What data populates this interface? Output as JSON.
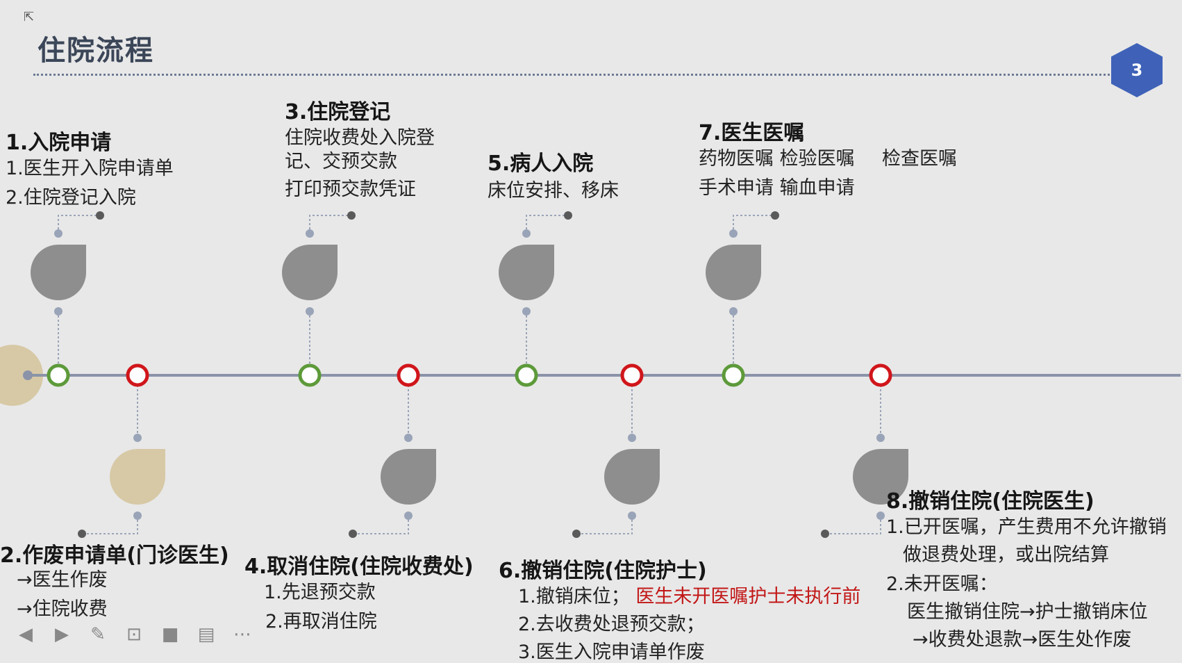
{
  "slide": {
    "title": "住院流程",
    "page_number": "3"
  },
  "steps": [
    {
      "id": "s1",
      "title": "1.入院申请",
      "lines": [
        "1.医生开入院申请单",
        "2.住院登记入院"
      ],
      "node_color": "green",
      "position": "top"
    },
    {
      "id": "s2",
      "title": "2.作废申请单(门诊医生)",
      "lines": [
        "→医生作废",
        "→住院收费"
      ],
      "node_color": "red",
      "position": "bottom"
    },
    {
      "id": "s3",
      "title": "3.住院登记",
      "lines": [
        "住院收费处入院登",
        "记、交预交款",
        "打印预交款凭证"
      ],
      "node_color": "green",
      "position": "top"
    },
    {
      "id": "s4",
      "title": "4.取消住院(住院收费处)",
      "lines": [
        "1.先退预交款",
        "2.再取消住院"
      ],
      "node_color": "red",
      "position": "bottom"
    },
    {
      "id": "s5",
      "title": "5.病人入院",
      "lines": [
        "床位安排、移床"
      ],
      "node_color": "green",
      "position": "top"
    },
    {
      "id": "s6",
      "title": "6.撤销住院(住院护士)",
      "lines": [
        "1.撤销床位；",
        "2.去收费处退预交款；",
        "3.医生入院申请单作废"
      ],
      "highlight": "医生未开医嘱护士未执行前",
      "node_color": "red",
      "position": "bottom"
    },
    {
      "id": "s7",
      "title": "7.医生医嘱",
      "lines": [
        "药物医嘱 检验医嘱",
        "检查医嘱",
        "手术申请 输血申请"
      ],
      "node_color": "green",
      "position": "top"
    },
    {
      "id": "s8",
      "title": "8.撤销住院(住院医生)",
      "lines": [
        "1.已开医嘱，产生费用不允许撤销",
        "做退费处理，或出院结算",
        "2.未开医嘱：",
        "医生撤销住院→护士撤销床位",
        "→收费处退款→医生处作废"
      ],
      "node_color": "red",
      "position": "bottom"
    }
  ],
  "colors": {
    "timeline": "#8a93a8",
    "green_node": "#5d9a3a",
    "red_node": "#d0161b",
    "drop_gray": "#8e8e8e",
    "drop_tan": "#d7c9a6",
    "connector": "#9aa4b8"
  },
  "toolbar": {
    "icons": [
      "prev-icon",
      "next-icon",
      "pen-icon",
      "screenshot-icon",
      "camera-icon",
      "comment-icon",
      "more-icon"
    ],
    "glyphs": [
      "◀",
      "▶",
      "✎",
      "⊡",
      "■",
      "▤",
      "⋯"
    ]
  }
}
